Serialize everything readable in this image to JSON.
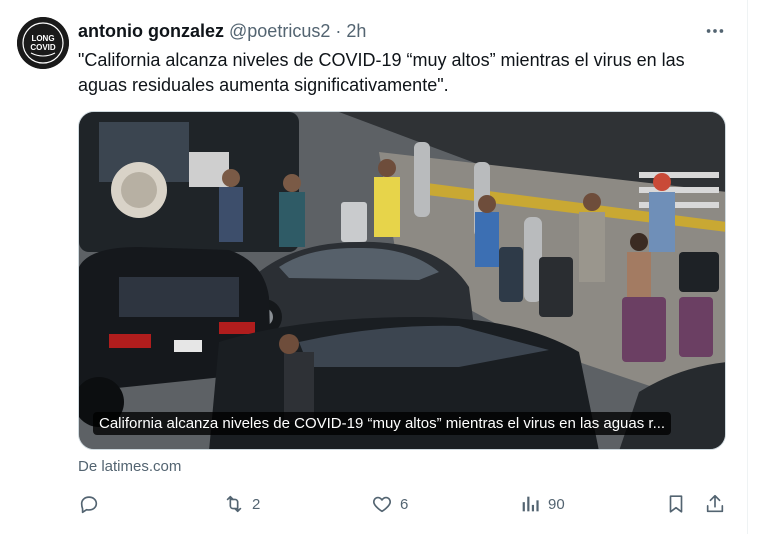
{
  "tweet": {
    "author_name": "antonio gonzalez",
    "handle": "@poetricus2",
    "separator": "·",
    "time": "2h",
    "text": "\"California alcanza niveles de COVID-19 “muy altos” mientras el virus en las aguas residuales aumenta significativamente\".",
    "avatar_text": [
      "LONG COVID",
      "AWARENESS"
    ],
    "media": {
      "caption": "California alcanza niveles de COVID-19 “muy altos” mientras el virus en las aguas r...",
      "source": "De latimes.com"
    },
    "actions": {
      "reply_count": "",
      "retweet_count": "2",
      "like_count": "6",
      "views_count": "90"
    }
  },
  "colors": {
    "text_primary": "#0f1419",
    "text_secondary": "#536471",
    "border": "#cfd9de"
  },
  "icons": [
    "more-icon",
    "reply-icon",
    "retweet-icon",
    "like-icon",
    "views-icon",
    "bookmark-icon",
    "share-icon"
  ]
}
